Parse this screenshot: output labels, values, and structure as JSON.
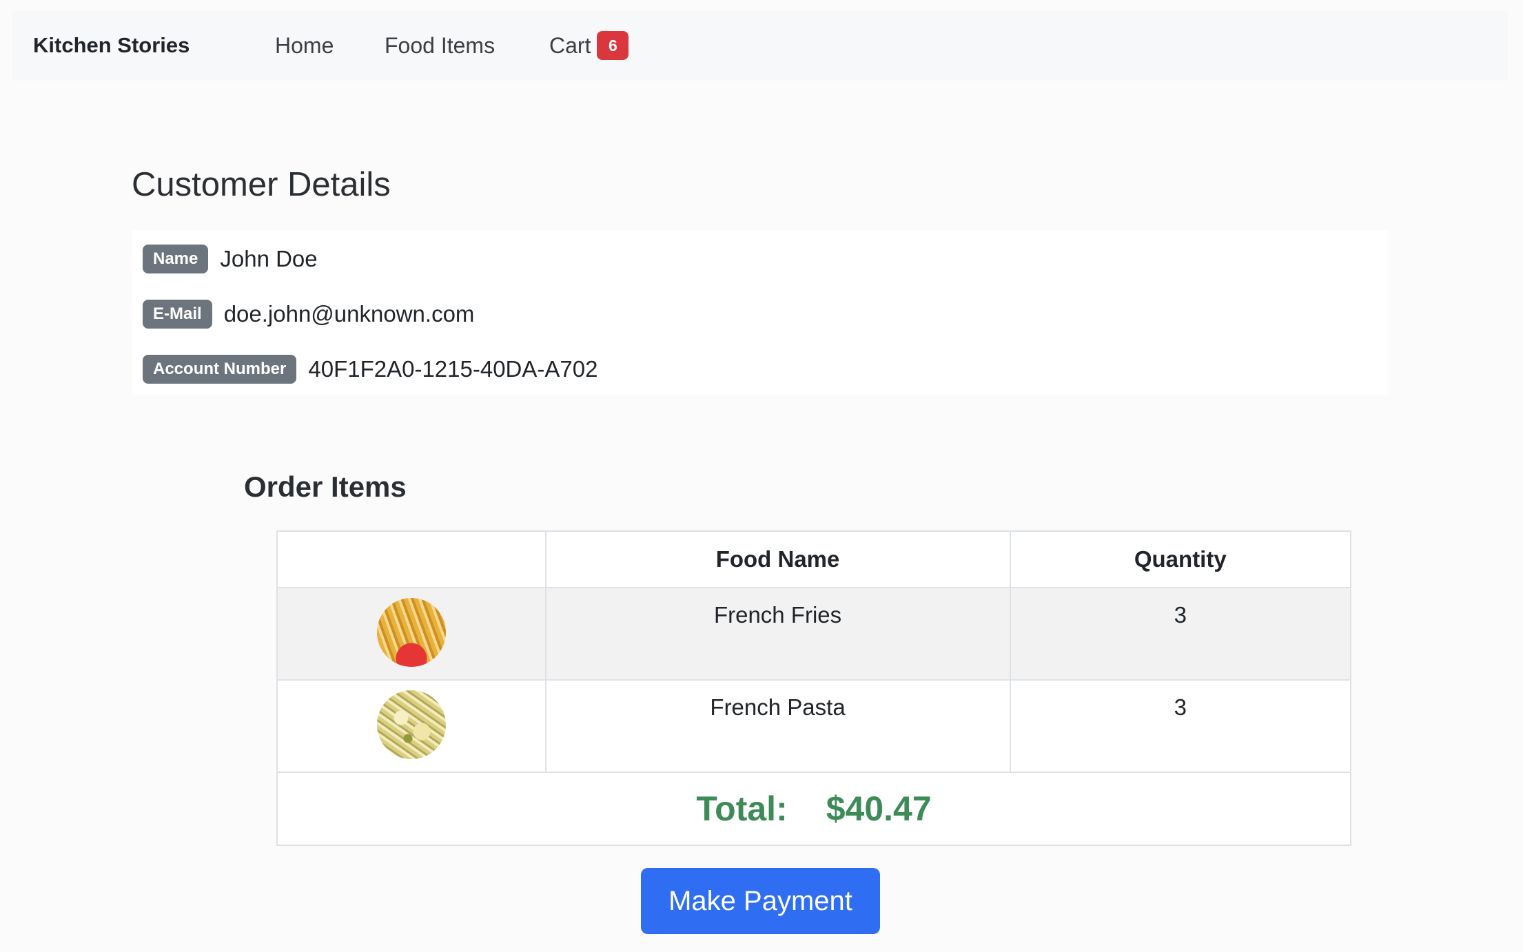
{
  "navbar": {
    "brand": "Kitchen Stories",
    "links": [
      {
        "label": "Home"
      },
      {
        "label": "Food Items"
      },
      {
        "label": "Cart",
        "badge": "6"
      }
    ]
  },
  "customer": {
    "title": "Customer Details",
    "fields": [
      {
        "label": "Name",
        "value": "John Doe"
      },
      {
        "label": "E-Mail",
        "value": "doe.john@unknown.com"
      },
      {
        "label": "Account Number",
        "value": "40F1F2A0-1215-40DA-A702"
      }
    ]
  },
  "order": {
    "title": "Order Items",
    "columns": [
      "",
      "Food Name",
      "Quantity"
    ],
    "rows": [
      {
        "image": "french-fries-image",
        "name": "French Fries",
        "quantity": "3"
      },
      {
        "image": "french-pasta-image",
        "name": "French Pasta",
        "quantity": "3"
      }
    ],
    "total_label": "Total:",
    "total_value": "$40.47"
  },
  "actions": {
    "pay_label": "Make Payment"
  },
  "colors": {
    "badge_red": "#d9363e",
    "label_gray": "#6c757d",
    "total_green": "#3d8b57",
    "primary_blue": "#2f6df2"
  }
}
